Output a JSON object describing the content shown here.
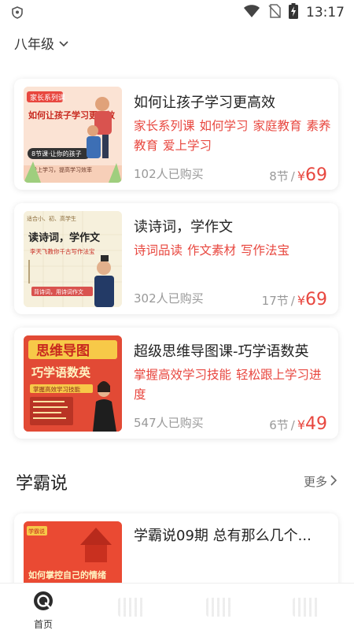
{
  "status_bar": {
    "time": "13:17",
    "icons": [
      "shield-icon",
      "wifi-icon",
      "no-sim-icon",
      "battery-charging-icon"
    ]
  },
  "grade_selector": {
    "label": "八年级"
  },
  "courses": [
    {
      "title": "如何让孩子学习更高效",
      "tags": [
        "家长系列课",
        "如何学习",
        "家庭教育",
        "素养教育",
        "爱上学习"
      ],
      "buyers": "102人已购买",
      "lessons": "8节",
      "currency": "¥",
      "price": "69",
      "thumb": {
        "badge": "家长系列课",
        "headline": "如何让孩子学习更高效",
        "banner": "8节课·让你的孩子",
        "footer": "爱上学习，提高学习效率"
      }
    },
    {
      "title": "读诗词，学作文",
      "tags": [
        "诗词品读",
        "作文素材",
        "写作法宝"
      ],
      "buyers": "302人已购买",
      "lessons": "17节",
      "currency": "¥",
      "price": "69",
      "thumb": {
        "top": "适合小、初、高学生",
        "headline": "读诗词，学作文",
        "subline": "李天飞教你千古写作法宝",
        "footer": "背诗词，用诗词作文"
      }
    },
    {
      "title": "超级思维导图课-巧学语数英",
      "tags": [
        "掌握高效学习技能",
        "轻松跟上学习进度"
      ],
      "buyers": "547人已购买",
      "lessons": "6节",
      "currency": "¥",
      "price": "49",
      "thumb": {
        "headline": "思维导图",
        "subline": "巧学语数英",
        "banner": "掌握高效学习技能"
      }
    }
  ],
  "section": {
    "title": "学霸说",
    "more_label": "更多"
  },
  "article": {
    "title": "学霸说09期 总有那么几个...",
    "thumb": {
      "badge": "学霸说",
      "headline": "如何掌控自己的情绪"
    }
  },
  "bottom_nav": {
    "home_label": "首页"
  },
  "colors": {
    "accent": "#e8473f",
    "muted": "#999999"
  }
}
